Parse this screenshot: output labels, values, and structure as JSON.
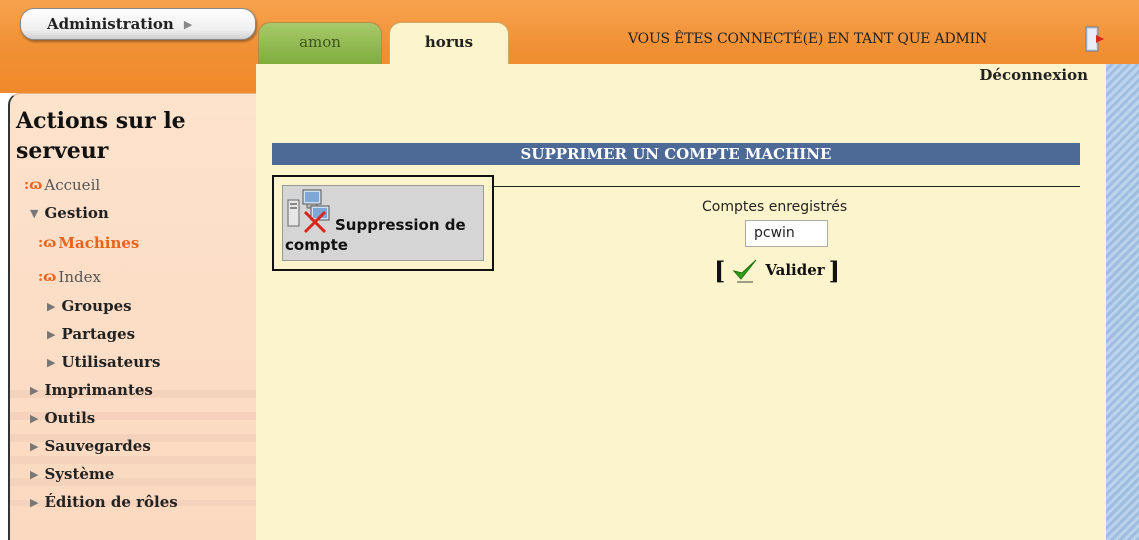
{
  "header": {
    "admin_label": "Administration",
    "tabs": [
      {
        "label": "amon"
      },
      {
        "label": "horus"
      }
    ],
    "connected_text": "VOUS ÊTES CONNECTÉ(E) EN TANT QUE ADMIN",
    "logout_label": "Déconnexion"
  },
  "sidebar": {
    "title_line1": "Actions sur le",
    "title_line2": "serveur",
    "items": [
      {
        "label": "Accueil"
      },
      {
        "label": "Gestion"
      },
      {
        "label": "Machines"
      },
      {
        "label": "Index"
      },
      {
        "label": "Groupes"
      },
      {
        "label": "Partages"
      },
      {
        "label": "Utilisateurs"
      },
      {
        "label": "Imprimantes"
      },
      {
        "label": "Outils"
      },
      {
        "label": "Sauvegardes"
      },
      {
        "label": "Système"
      },
      {
        "label": "Édition de rôles"
      }
    ]
  },
  "main": {
    "section_title": "SUPPRIMER UN COMPTE MACHINE",
    "action_line1": "Suppression de",
    "action_line2": "compte",
    "field_label": "Comptes enregistrés",
    "field_value": "pcwin",
    "bracket_open": "[",
    "bracket_close": "]",
    "submit_label": "Valider"
  },
  "colors": {
    "header_orange": "#f08f33",
    "content_bg": "#fcf4cc",
    "sidebar_bg": "#fde2cc",
    "section_bar": "#4d6996",
    "active_item": "#e8641c"
  }
}
